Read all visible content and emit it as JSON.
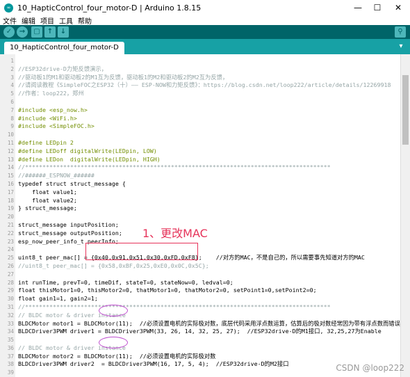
{
  "window": {
    "title": "10_HapticControl_four_motor-D | Arduino 1.8.15",
    "icon_text": "∞",
    "minimize": "—",
    "maximize": "☐",
    "close": "✕"
  },
  "menu": [
    "文件",
    "编辑",
    "项目",
    "工具",
    "帮助"
  ],
  "toolbar": {
    "verify": "✓",
    "upload": "→",
    "new": "▢",
    "open": "↑",
    "save": "↓",
    "serial": "⚲"
  },
  "tab": {
    "label": "10_HapticControl_four_motor-D",
    "menu": "▾"
  },
  "code_lines": [
    {
      "n": "1",
      "text": ""
    },
    {
      "n": "2",
      "text": "//ESP32drive-D力矩反馈演示，"
    },
    {
      "n": "3",
      "text": "//驱动板1的M1和驱动板2的M1互为反馈，驱动板1的M2和驱动板2的M2互为反馈，"
    },
    {
      "n": "4",
      "text": "//请阅读教程《SimpleFOC之ESP32（十）—— ESP-NOW和力矩反馈》：https://blog.csdn.net/loop222/article/details/12269918"
    },
    {
      "n": "5",
      "text": "//作者：loop222，郑州"
    },
    {
      "n": "6",
      "text": ""
    },
    {
      "n": "7",
      "text": "#include <esp_now.h>"
    },
    {
      "n": "8",
      "text": "#include <WiFi.h>"
    },
    {
      "n": "9",
      "text": "#include <SimpleFOC.h>"
    },
    {
      "n": "10",
      "text": ""
    },
    {
      "n": "11",
      "text": "#define LEDpin 2"
    },
    {
      "n": "12",
      "text": "#define LEDoff digitalWrite(LEDpin, LOW)"
    },
    {
      "n": "13",
      "text": "#define LEDon  digitalWrite(LEDpin, HIGH)"
    },
    {
      "n": "14",
      "text": "//****************************************************************************************"
    },
    {
      "n": "15",
      "text": "//######_ESPNOW_######"
    },
    {
      "n": "16",
      "text": "typedef struct struct_message {"
    },
    {
      "n": "17",
      "text": "    float value1;"
    },
    {
      "n": "18",
      "text": "    float value2;"
    },
    {
      "n": "19",
      "text": "} struct_message;"
    },
    {
      "n": "20",
      "text": ""
    },
    {
      "n": "21",
      "text": "struct_message inputPosition;"
    },
    {
      "n": "22",
      "text": "struct_message outputPosition;"
    },
    {
      "n": "23",
      "text": "esp_now_peer_info_t peerInfo;"
    },
    {
      "n": "24",
      "text": ""
    },
    {
      "n": "25",
      "text": "uint8_t peer_mac[] = {0x40,0x91,0x51,0x30,0xFD,0xF8};    //对方的MAC，不是自己的，所以需要事先知道对方的MAC"
    },
    {
      "n": "26",
      "text": "//uint8_t peer_mac[] = {0x58,0xBF,0x25,0xE0,0x0C,0x5C};"
    },
    {
      "n": "27",
      "text": ""
    },
    {
      "n": "28",
      "text": "int runTime, prevT=0, timeDif, stateT=0, stateNow=0, ledval=0;"
    },
    {
      "n": "29",
      "text": "float thisMotor1=0, thisMotor2=0, thatMotor1=0, thatMotor2=0, setPoint1=0,setPoint2=0;"
    },
    {
      "n": "30",
      "text": "float gain1=1, gain2=1;"
    },
    {
      "n": "31",
      "text": "//****************************************************************************************"
    },
    {
      "n": "32",
      "text": "// BLDC motor & driver instance"
    },
    {
      "n": "33",
      "text": "BLDCMotor motor1 = BLDCMotor(11);  //必须设置电机的实际极对数，底层代码采用浮点数运算，估算后的极对数经常因为带有浮点数而错误"
    },
    {
      "n": "34",
      "text": "BLDCDriver3PWM driver1 = BLDCDriver3PWM(33, 26, 14, 32, 25, 27);  //ESP32drive-D的M1接口, 32,25,27为Enable"
    },
    {
      "n": "35",
      "text": ""
    },
    {
      "n": "36",
      "text": "// BLDC motor & driver instance"
    },
    {
      "n": "37",
      "text": "BLDCMotor motor2 = BLDCMotor(11);  //必须设置电机的实际极对数"
    },
    {
      "n": "38",
      "text": "BLDCDriver3PWM driver2  = BLDCDriver3PWM(16, 17, 5, 4);  //ESP32drive-D的M2接口"
    },
    {
      "n": "39",
      "text": ""
    }
  ],
  "annotation": "1、更改MAC",
  "watermark": "CSDN @loop222",
  "colors": {
    "toolbar": "#006468",
    "tabstrip": "#17a1a5",
    "annotation": "#e6335a",
    "keyword_type": "#00979c",
    "keyword_func": "#d35400",
    "comment": "#95a5a6",
    "preprocessor": "#728e00"
  }
}
